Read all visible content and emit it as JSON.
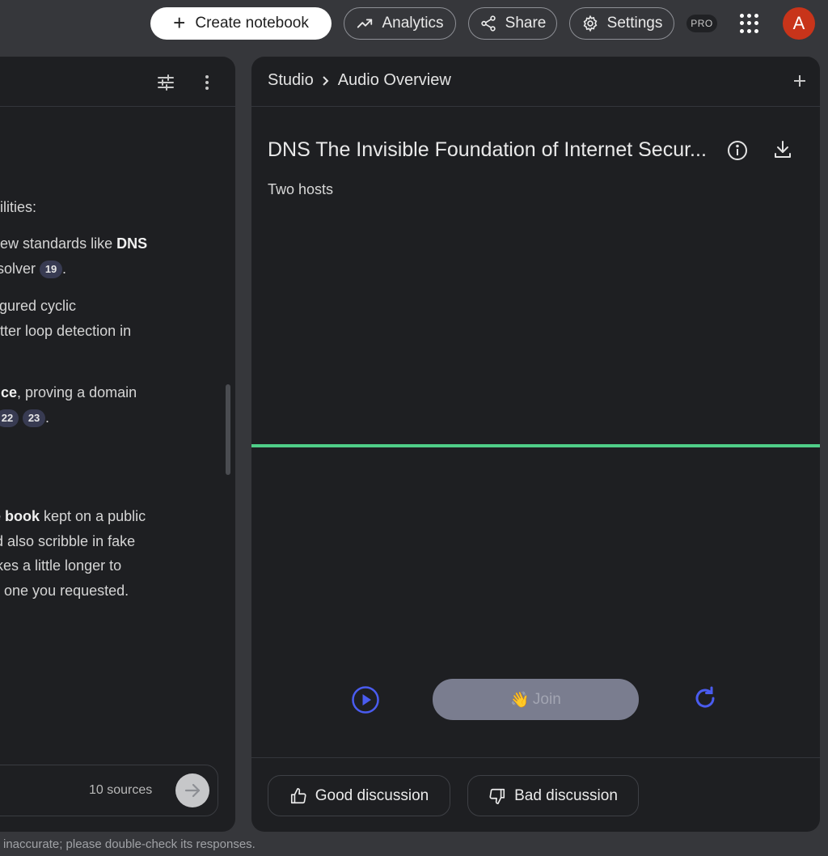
{
  "topbar": {
    "create_label": "Create notebook",
    "analytics_label": "Analytics",
    "share_label": "Share",
    "settings_label": "Settings",
    "pro_badge": "PRO",
    "avatar_letter": "A"
  },
  "left_panel": {
    "lines": [
      {
        "pre": "abilities:",
        "bold": "",
        "post": ""
      },
      {
        "pre": ", new standards like ",
        "bold": "DNS",
        "post": ""
      },
      {
        "pre": " resolver",
        "bold": "",
        "post": ""
      },
      {
        "pre": "nfigured cyclic",
        "bold": "",
        "post": ""
      },
      {
        "pre": "better loop detection in",
        "bold": "",
        "post": ""
      },
      {
        "pre": "",
        "bold": "ence",
        "post": ", proving a domain"
      },
      {
        "pre": "e",
        "bold": "",
        "post": ""
      },
      {
        "pre": "",
        "bold": "ne book",
        "post": " kept on a public"
      },
      {
        "pre": "uld also scribble in fake",
        "bold": "",
        "post": ""
      },
      {
        "pre": " takes a little longer to",
        "bold": "",
        "post": ""
      },
      {
        "pre": "he one you requested.",
        "bold": "",
        "post": ""
      }
    ],
    "citations": [
      "19",
      "22",
      "23"
    ],
    "sources_count": "10 sources"
  },
  "studio": {
    "breadcrumb_root": "Studio",
    "breadcrumb_current": "Audio Overview",
    "title": "DNS The Invisible Foundation of Internet Secur...",
    "subtitle": "Two hosts",
    "join_emoji": "👋",
    "join_label": "Join",
    "good_label": "Good discussion",
    "bad_label": "Bad discussion",
    "accent_color": "#4a5cf0",
    "waveform_color": "#4fce88"
  },
  "footer": {
    "disclaimer": "inaccurate; please double-check its responses."
  }
}
